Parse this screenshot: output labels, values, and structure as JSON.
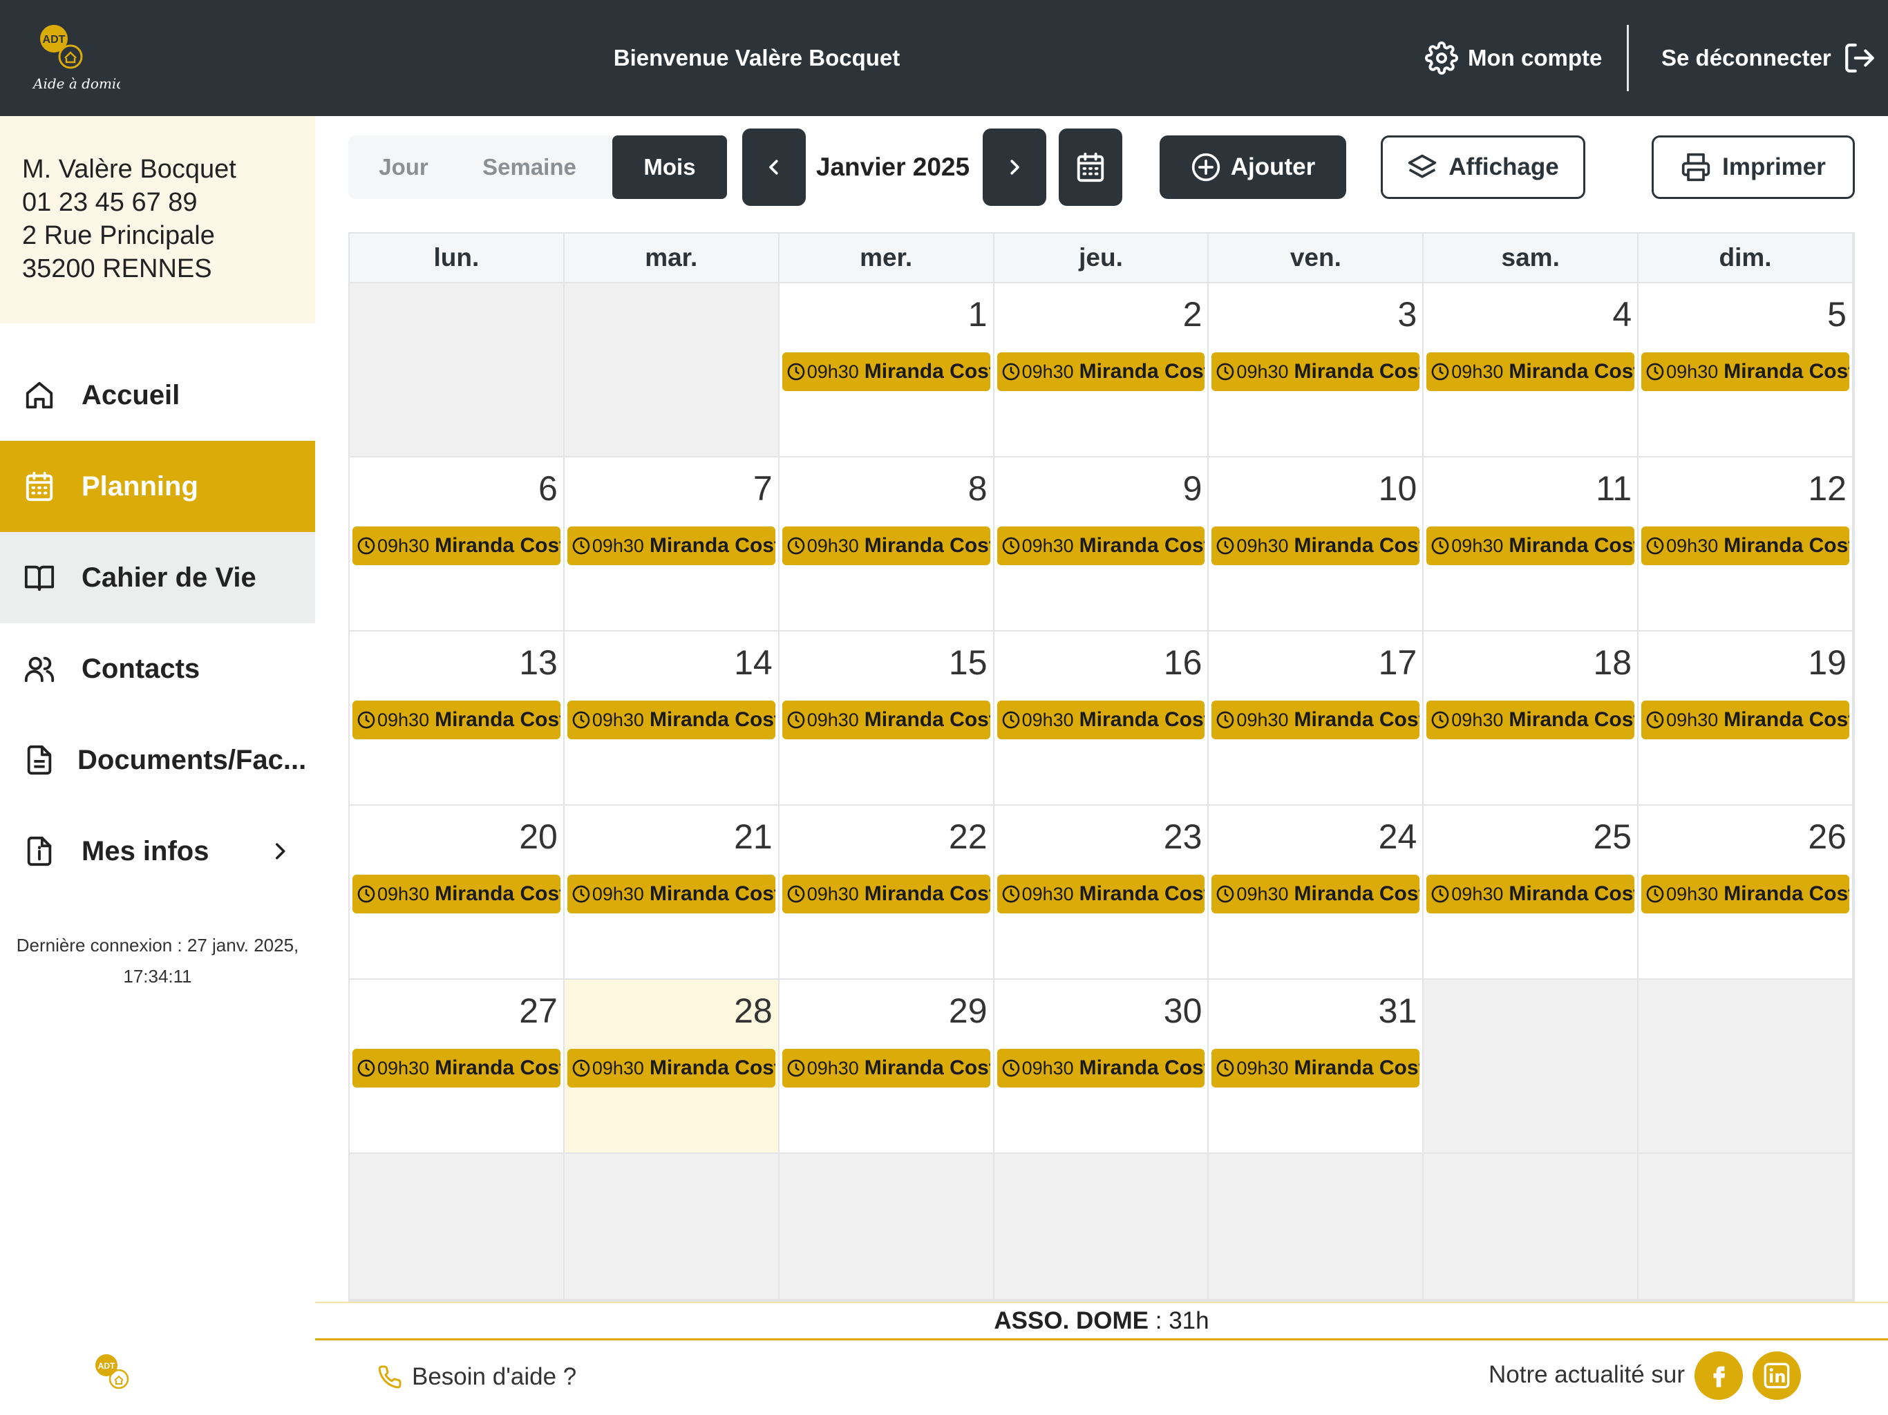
{
  "header": {
    "welcome": "Bienvenue Valère Bocquet",
    "account_label": "Mon compte",
    "logout_label": "Se déconnecter",
    "logo_text": "Aide à domicile"
  },
  "user": {
    "name": "M. Valère Bocquet",
    "phone": "01 23 45 67 89",
    "street": "2 Rue Principale",
    "city": "35200 RENNES"
  },
  "nav": {
    "items": [
      {
        "label": "Accueil",
        "icon": "home-icon"
      },
      {
        "label": "Planning",
        "icon": "calendar-icon"
      },
      {
        "label": "Cahier de Vie",
        "icon": "book-icon"
      },
      {
        "label": "Contacts",
        "icon": "users-icon"
      },
      {
        "label": "Documents/Fac...",
        "icon": "document-icon"
      },
      {
        "label": "Mes infos",
        "icon": "info-icon"
      }
    ],
    "last_connection_line1": "Dernière connexion : 27 janv. 2025,",
    "last_connection_line2": "17:34:11"
  },
  "toolbar": {
    "tabs": [
      "Jour",
      "Semaine",
      "Mois"
    ],
    "active_tab": "Mois",
    "month_label": "Janvier 2025",
    "add_label": "Ajouter",
    "display_label": "Affichage",
    "print_label": "Imprimer"
  },
  "calendar": {
    "weekdays": [
      "lun.",
      "mar.",
      "mer.",
      "jeu.",
      "ven.",
      "sam.",
      "dim."
    ],
    "weeks": [
      [
        null,
        null,
        1,
        2,
        3,
        4,
        5
      ],
      [
        6,
        7,
        8,
        9,
        10,
        11,
        12
      ],
      [
        13,
        14,
        15,
        16,
        17,
        18,
        19
      ],
      [
        20,
        21,
        22,
        23,
        24,
        25,
        26
      ],
      [
        27,
        28,
        29,
        30,
        31,
        null,
        null
      ],
      [
        null,
        null,
        null,
        null,
        null,
        null,
        null
      ]
    ],
    "today": 28,
    "event": {
      "time": "09h30",
      "name": "Miranda Coste"
    }
  },
  "summary": {
    "label": "ASSO. DOME",
    "value": " : 31h"
  },
  "footer": {
    "help_label": "Besoin d'aide ?",
    "news_label": "Notre actualité sur"
  },
  "colors": {
    "accent": "#dbab0a",
    "dark": "#2c343a",
    "sidebar_card": "#fcf7e6"
  }
}
